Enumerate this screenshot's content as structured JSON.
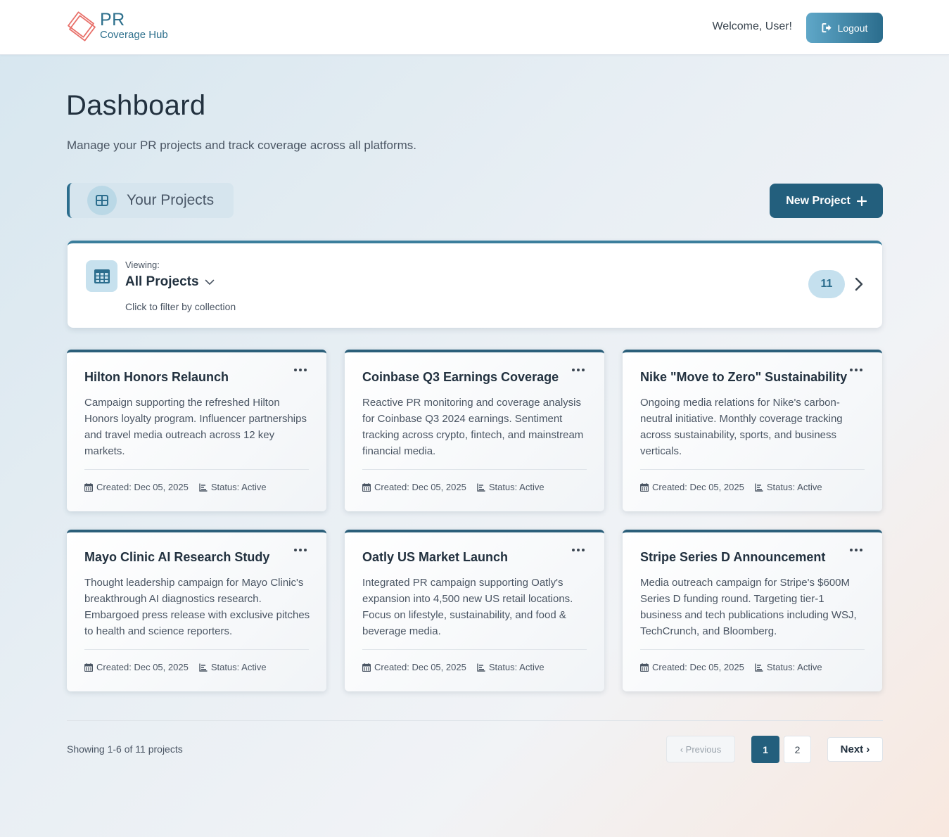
{
  "header": {
    "logo_title": "PR",
    "logo_subtitle": "Coverage Hub",
    "welcome": "Welcome, User!",
    "logout_label": "Logout"
  },
  "page": {
    "title": "Dashboard",
    "subtitle": "Manage your PR projects and track coverage across all platforms."
  },
  "section": {
    "label": "Your Projects",
    "new_project_label": "New Project"
  },
  "filter": {
    "viewing_label": "Viewing:",
    "viewing_value": "All Projects",
    "hint": "Click to filter by collection",
    "count": "11"
  },
  "projects": [
    {
      "title": "Hilton Honors Relaunch",
      "description": "Campaign supporting the refreshed Hilton Honors loyalty program. Influencer partnerships and travel media outreach across 12 key markets.",
      "created": "Created: Dec 05, 2025",
      "status": "Status: Active"
    },
    {
      "title": "Coinbase Q3 Earnings Coverage",
      "description": "Reactive PR monitoring and coverage analysis for Coinbase Q3 2024 earnings. Sentiment tracking across crypto, fintech, and mainstream financial media.",
      "created": "Created: Dec 05, 2025",
      "status": "Status: Active"
    },
    {
      "title": "Nike \"Move to Zero\" Sustainability",
      "description": "Ongoing media relations for Nike's carbon-neutral initiative. Monthly coverage tracking across sustainability, sports, and business verticals.",
      "created": "Created: Dec 05, 2025",
      "status": "Status: Active"
    },
    {
      "title": "Mayo Clinic AI Research Study",
      "description": "Thought leadership campaign for Mayo Clinic's breakthrough AI diagnostics research. Embargoed press release with exclusive pitches to health and science reporters.",
      "created": "Created: Dec 05, 2025",
      "status": "Status: Active"
    },
    {
      "title": "Oatly US Market Launch",
      "description": "Integrated PR campaign supporting Oatly's expansion into 4,500 new US retail locations. Focus on lifestyle, sustainability, and food & beverage media.",
      "created": "Created: Dec 05, 2025",
      "status": "Status: Active"
    },
    {
      "title": "Stripe Series D Announcement",
      "description": "Media outreach campaign for Stripe's $600M Series D funding round. Targeting tier-1 business and tech publications including WSJ, TechCrunch, and Bloomberg.",
      "created": "Created: Dec 05, 2025",
      "status": "Status: Active"
    }
  ],
  "pagination": {
    "showing": "Showing 1-6 of 11 projects",
    "previous": "‹ Previous",
    "page1": "1",
    "page2": "2",
    "next": "Next ›"
  },
  "colors": {
    "accent": "#235f7d",
    "logo": "#e8706a"
  },
  "icons": [
    "logo-diamond-icon",
    "logout-icon",
    "grid-icon",
    "plus-icon",
    "table-icon",
    "chevron-down-icon",
    "chevron-right-icon",
    "more-dots-icon",
    "calendar-icon",
    "chart-icon"
  ]
}
